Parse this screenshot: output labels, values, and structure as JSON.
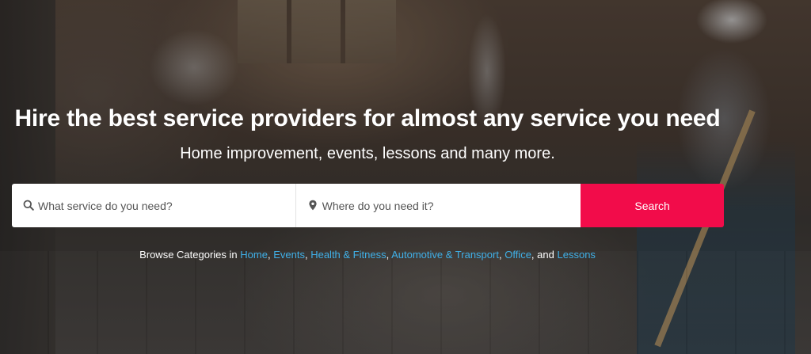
{
  "hero": {
    "headline": "Hire the best service providers for almost any service you need",
    "subheadline": "Home improvement, events, lessons and many more."
  },
  "search": {
    "service_placeholder": "What service do you need?",
    "location_placeholder": "Where do you need it?",
    "button_label": "Search",
    "button_color": "#f20c4a"
  },
  "categories": {
    "prefix": "Browse Categories in",
    "links": [
      "Home",
      "Events",
      "Health & Fitness",
      "Automotive & Transport",
      "Office",
      "Lessons"
    ],
    "separator": ",",
    "conjunction": "and",
    "link_color": "#3fb0e8"
  },
  "icons": {
    "service_field": "search-icon",
    "location_field": "map-pin-icon"
  }
}
